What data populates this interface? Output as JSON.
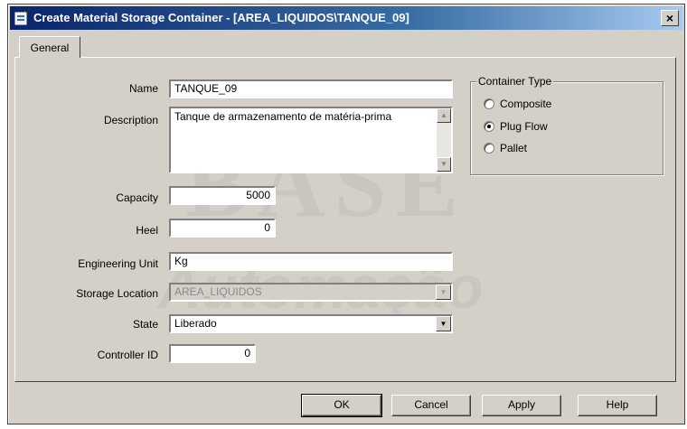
{
  "window": {
    "title": "Create Material Storage Container - [AREA_LIQUIDOS\\TANQUE_09]",
    "close_label": "×"
  },
  "tabs": [
    {
      "label": "General"
    }
  ],
  "watermark": {
    "line1": "BASE",
    "line2": "Automação"
  },
  "form": {
    "name": {
      "label": "Name",
      "value": "TANQUE_09"
    },
    "description": {
      "label": "Description",
      "value": "Tanque de armazenamento de matéria-prima"
    },
    "capacity": {
      "label": "Capacity",
      "value": "5000"
    },
    "heel": {
      "label": "Heel",
      "value": "0"
    },
    "engineering_unit": {
      "label": "Engineering Unit",
      "value": "Kg"
    },
    "storage_location": {
      "label": "Storage Location",
      "value": "AREA_LIQUIDOS"
    },
    "state": {
      "label": "State",
      "value": "Liberado"
    },
    "controller_id": {
      "label": "Controller ID",
      "value": "0"
    }
  },
  "container_type": {
    "title": "Container Type",
    "options": [
      {
        "label": "Composite",
        "checked": false
      },
      {
        "label": "Plug Flow",
        "checked": true
      },
      {
        "label": "Pallet",
        "checked": false
      }
    ]
  },
  "buttons": {
    "ok": "OK",
    "cancel": "Cancel",
    "apply": "Apply",
    "help": "Help"
  },
  "icons": {
    "scroll_up": "▲",
    "scroll_down": "▼",
    "dropdown": "▼"
  }
}
